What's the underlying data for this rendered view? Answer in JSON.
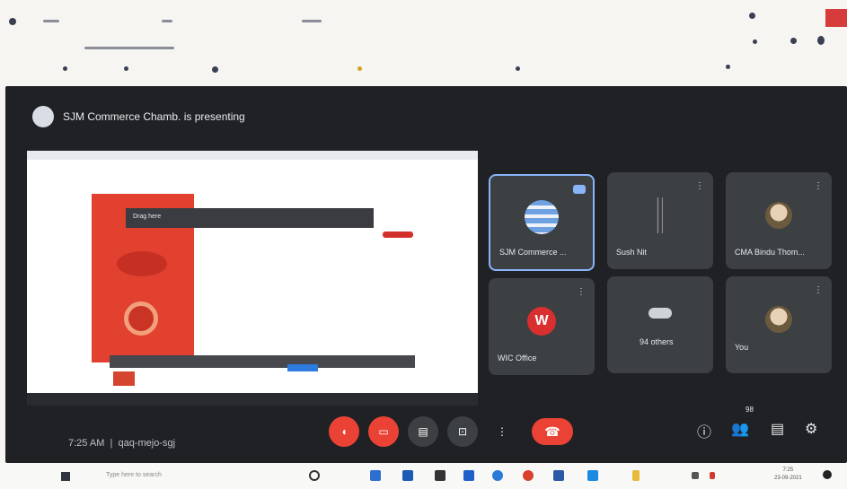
{
  "meeting": {
    "presenter_text": "SJM Commerce Chamb. is presenting",
    "shared_label": "Drag here"
  },
  "tiles": [
    {
      "name": "SJM Commerce ...",
      "avatar": "globe-avatar-icon"
    },
    {
      "name": "Sush Nit",
      "avatar": "sketch-avatar-icon"
    },
    {
      "name": "CMA Bindu Thom...",
      "avatar": "photo-avatar-icon"
    },
    {
      "name": "WIC Office",
      "avatar": "w-avatar-icon",
      "initial": "W"
    },
    {
      "name": "94 others",
      "avatar": "group-avatar-icon"
    },
    {
      "name": "You",
      "avatar": "photo-avatar-icon"
    }
  ],
  "controls": {
    "time": "7:25 AM",
    "meeting_code": "qaq-mejo-sgj",
    "people_count": "98",
    "end_call_icon": "end-call-icon"
  },
  "taskbar": {
    "search_placeholder": "Type here to search",
    "clock_time": "7:25",
    "clock_date": "23-09-2021"
  },
  "colors": {
    "meet_bg": "#202124",
    "tile_bg": "#3c4043",
    "accent": "#8ab4f8",
    "danger": "#ea4335"
  }
}
